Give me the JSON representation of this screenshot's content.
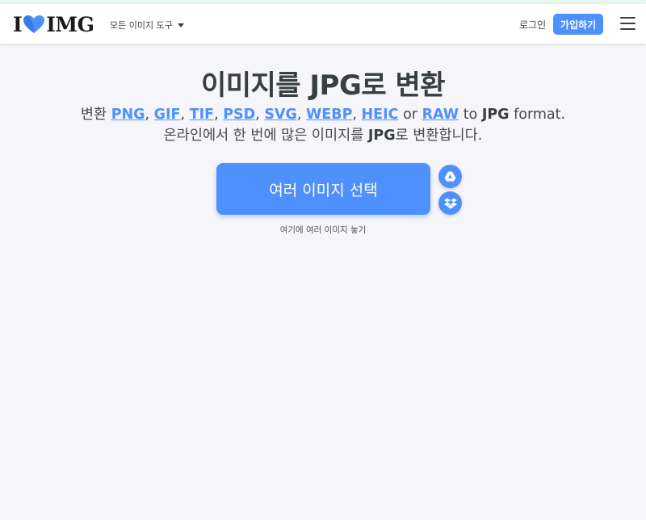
{
  "header": {
    "logo": {
      "part1": "I",
      "part2": "IMG"
    },
    "tools_menu": "모든 이미지 도구",
    "login": "로그인",
    "signup": "가입하기"
  },
  "main": {
    "title": "이미지를 JPG로 변환",
    "subtitle1": {
      "prefix": "변환",
      "formats": [
        "PNG",
        "GIF",
        "TIF",
        "PSD",
        "SVG",
        "WEBP",
        "HEIC"
      ],
      "or": "or",
      "last_format": "RAW",
      "to": "to",
      "target": "JPG",
      "suffix": "format."
    },
    "subtitle2": {
      "before": "온라인에서 한 번에 많은 이미지를",
      "target": "JPG",
      "after": "로 변환합니다."
    },
    "select_button": "여러 이미지 선택",
    "drop_hint": "여기에 여러 이미지 놓기"
  },
  "icons": {
    "heart": "heart-icon",
    "caret": "caret-down-icon",
    "menu": "hamburger-menu-icon",
    "drive": "google-drive-icon",
    "dropbox": "dropbox-icon"
  },
  "colors": {
    "accent": "#4d90fe",
    "text": "#383e45",
    "background": "#f5f5fa"
  }
}
